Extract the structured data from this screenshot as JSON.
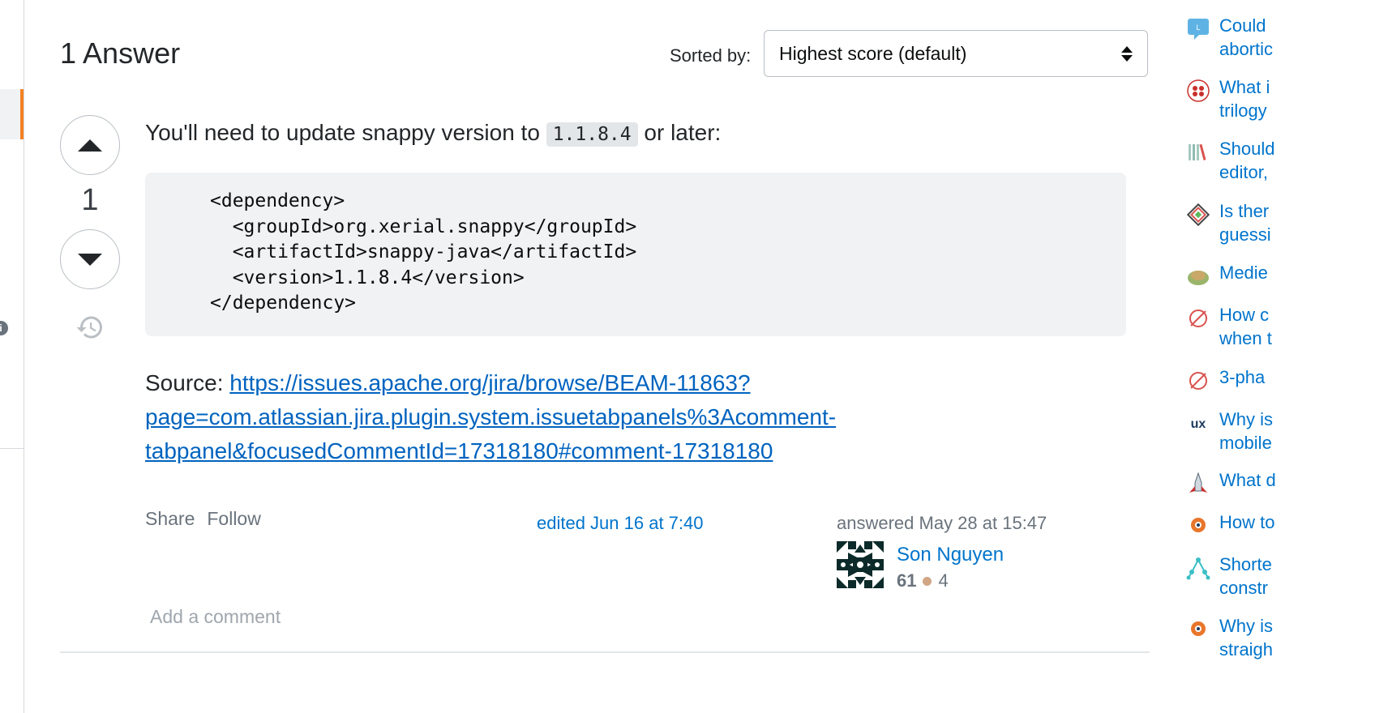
{
  "answers": {
    "title": "1 Answer",
    "sort_label": "Sorted by:",
    "sort_value": "Highest score (default)"
  },
  "answer": {
    "score": "1",
    "lead_text": "You'll need to update snappy version to",
    "inline_code": "1.1.8.4",
    "lead_suffix": "or later:",
    "code_block": "<dependency>\n  <groupId>org.xerial.snappy</groupId>\n  <artifactId>snappy-java</artifactId>\n  <version>1.1.8.4</version>\n</dependency>",
    "source_label": "Source:",
    "source_url": "https://issues.apache.org/jira/browse/BEAM-11863?page=com.atlassian.jira.plugin.system.issuetabpanels%3Acomment-tabpanel&focusedCommentId=17318180#comment-17318180",
    "share_label": "Share",
    "follow_label": "Follow",
    "edited_text": "edited Jun 16 at 7:40",
    "answered_text": "answered May 28 at 15:47",
    "user": {
      "name": "Son Nguyen",
      "reputation": "61",
      "bronze_badges": "4"
    },
    "add_comment": "Add a comment"
  },
  "hot_network_questions": [
    {
      "title": "Could\nabortic",
      "icon": "chat-bubble-icon",
      "color": "#3b9ad9"
    },
    {
      "title": "What i\ntrilogy",
      "icon": "skeptics-icon",
      "color": "#c9302c"
    },
    {
      "title": "Should\neditor,",
      "icon": "books-icon",
      "color": "#7fb3a8"
    },
    {
      "title": "Is ther\nguessi",
      "icon": "puzzling-icon",
      "color": "#d9534f"
    },
    {
      "title": "Medie",
      "icon": "globe-icon",
      "color": "#8fb05a"
    },
    {
      "title": "How c\nwhen t",
      "icon": "no-symbol-icon",
      "color": "#d9534f"
    },
    {
      "title": "3-pha",
      "icon": "no-symbol-icon",
      "color": "#d9534f"
    },
    {
      "title": "Why is\nmobile",
      "icon": "ux-logo-icon",
      "color": "#1e3a5f"
    },
    {
      "title": "What d",
      "icon": "rocket-icon",
      "color": "#c9302c"
    },
    {
      "title": "How to",
      "icon": "location-pin-icon",
      "color": "#e8762c"
    },
    {
      "title": "Shorte\nconstr",
      "icon": "network-icon",
      "color": "#3bbfc5"
    },
    {
      "title": "Why is\nstraigh",
      "icon": "location-pin-icon",
      "color": "#e8762c"
    }
  ]
}
